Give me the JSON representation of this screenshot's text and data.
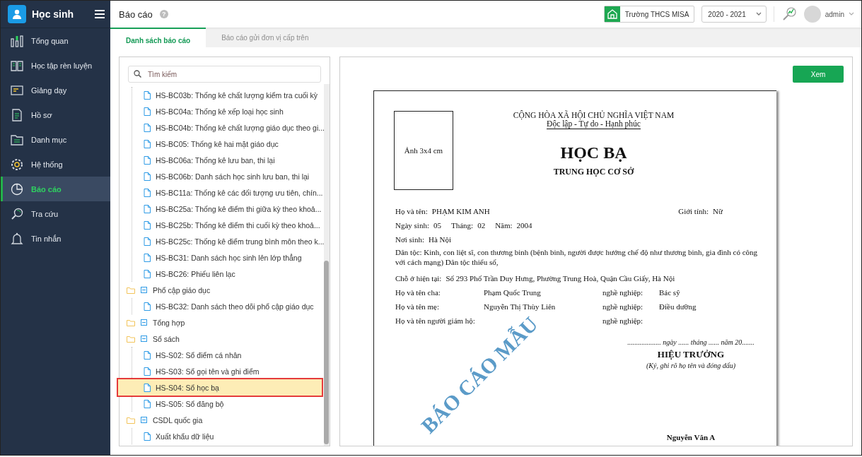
{
  "app": {
    "title": "Học sinh"
  },
  "sidebar": {
    "items": [
      {
        "label": "Tổng quan",
        "selected": false
      },
      {
        "label": "Học tập rèn luyện",
        "selected": false
      },
      {
        "label": "Giảng dạy",
        "selected": false
      },
      {
        "label": "Hồ sơ",
        "selected": false
      },
      {
        "label": "Danh mục",
        "selected": false
      },
      {
        "label": "Hệ thống",
        "selected": false
      },
      {
        "label": "Báo cáo",
        "selected": true
      },
      {
        "label": "Tra cứu",
        "selected": false
      },
      {
        "label": "Tin nhắn",
        "selected": false
      }
    ]
  },
  "header": {
    "title": "Báo cáo",
    "help": "?",
    "school": "Trường THCS MISA",
    "year": "2020 - 2021",
    "user": "admin"
  },
  "tabs": [
    {
      "label": "Danh sách báo cáo",
      "selected": true
    },
    {
      "label": "Báo cáo gửi đơn vị cấp trên",
      "selected": false
    }
  ],
  "search": {
    "placeholder": "Tìm kiếm"
  },
  "tree": [
    {
      "children": [
        {
          "label": "HS-BC03b: Thống kê chất lượng kiểm tra cuối kỳ",
          "selected": false
        },
        {
          "label": "HS-BC04a: Thống kê xếp loại học sinh",
          "selected": false
        },
        {
          "label": "HS-BC04b: Thống kê chất lượng giáo dục theo gi...",
          "selected": false
        },
        {
          "label": "HS-BC05: Thống kê hai mặt giáo dục",
          "selected": false
        },
        {
          "label": "HS-BC06a: Thống kê lưu ban, thi lại",
          "selected": false
        },
        {
          "label": "HS-BC06b: Danh sách học sinh lưu ban, thi lại",
          "selected": false
        },
        {
          "label": "HS-BC11a: Thống kê các đối tượng ưu tiên, chín...",
          "selected": false
        },
        {
          "label": "HS-BC25a: Thống kê điểm thi giữa kỳ theo khoả...",
          "selected": false
        },
        {
          "label": "HS-BC25b: Thống kê điểm thi cuối kỳ theo khoả...",
          "selected": false
        },
        {
          "label": "HS-BC25c: Thống kê điểm trung bình môn theo k...",
          "selected": false
        },
        {
          "label": "HS-BC31: Danh sách học sinh lên lớp thẳng",
          "selected": false
        },
        {
          "label": "HS-BC26: Phiếu liên lạc",
          "selected": false
        }
      ]
    },
    {
      "label": "Phổ cập giáo dục",
      "expanded": true,
      "children": [
        {
          "label": "HS-BC32: Danh sách theo dõi phổ cập giáo dục",
          "selected": false
        }
      ]
    },
    {
      "label": "Tổng hợp",
      "expanded": true
    },
    {
      "label": "Sổ sách",
      "expanded": true,
      "children": [
        {
          "label": "HS-S02: Sổ điểm cá nhân",
          "selected": false
        },
        {
          "label": "HS-S03: Sổ gọi tên và ghi điểm",
          "selected": false
        },
        {
          "label": "HS-S04: Sổ học bạ",
          "selected": true
        },
        {
          "label": "HS-S05: Sổ đăng bộ",
          "selected": false
        }
      ]
    },
    {
      "label": "CSDL quốc gia",
      "expanded": true,
      "children": [
        {
          "label": "Xuất khẩu dữ liệu",
          "selected": false
        }
      ]
    }
  ],
  "view_button": "Xem",
  "document": {
    "photo_label": "Ảnh 3x4 cm",
    "nation": "CỘNG HÒA XÃ HỘI CHỦ NGHĨA VIỆT NAM",
    "motto": "Độc lập - Tự do - Hạnh phúc",
    "title": "HỌC BẠ",
    "subtitle": "TRUNG HỌC CƠ SỞ",
    "name_label": "Họ và tên:",
    "name": "PHẠM KIM ANH",
    "gender_label": "Giới tính:",
    "gender": "Nữ",
    "birth": [
      {
        "label": "Ngày sinh:",
        "value": "05"
      },
      {
        "label": "Tháng:",
        "value": "02"
      },
      {
        "label": "Năm:",
        "value": "2004"
      }
    ],
    "birthplace_label": "Nơi sinh:",
    "birthplace": "Hà Nội",
    "ethnicity": "Dân tộc: Kinh, con liệt sĩ, con thương binh (bệnh binh, người được hưởng chế độ như thương binh, gia đình có công với cách mạng) Dân tộc thiểu số,",
    "address_label": "Chỗ ở hiện tại:",
    "address": "Số 293 Phố Trần Duy Hưng, Phường Trung Hoà, Quận Cầu Giấy, Hà Nội",
    "guardians": [
      {
        "label": "Họ và tên cha:",
        "name": "Phạm Quốc Trung",
        "job_label": "nghề nghiệp:",
        "job": "Bác sỹ"
      },
      {
        "label": "Họ và tên mẹ:",
        "name": "Nguyễn Thị Thùy Liên",
        "job_label": "nghề nghiệp:",
        "job": "Điều dưỡng"
      },
      {
        "label": "Họ và tên người giám hộ:",
        "job_label": "nghề nghiệp:"
      }
    ],
    "date_line": "................... ngày ...... tháng ...... năm 20.......",
    "signer_title": "HIỆU TRƯỞNG",
    "signer_note": "(Ký, ghi rõ họ tên và đóng dấu)",
    "signer_name": "Nguyễn Văn A",
    "watermark": "BÁO CÁO MẪU"
  }
}
